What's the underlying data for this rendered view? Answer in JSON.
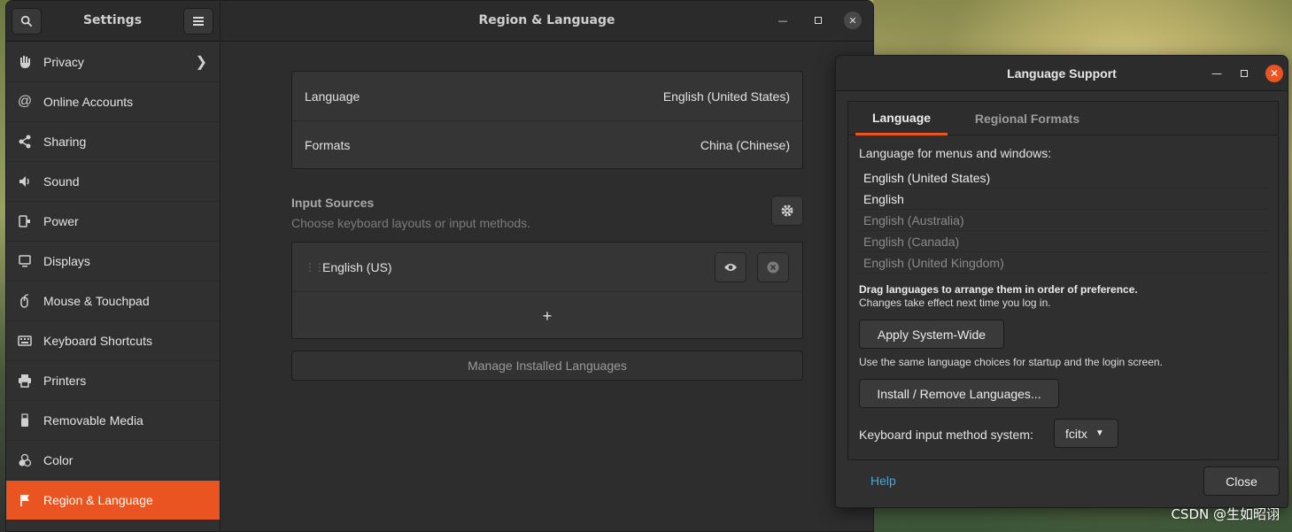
{
  "settings_window": {
    "sidebar_title": "Settings",
    "page_title": "Region & Language",
    "sidebar": [
      {
        "label": "Privacy",
        "icon": "hand-icon",
        "has_arrow": true
      },
      {
        "label": "Online Accounts",
        "icon": "at-icon"
      },
      {
        "label": "Sharing",
        "icon": "share-icon"
      },
      {
        "label": "Sound",
        "icon": "speaker-icon"
      },
      {
        "label": "Power",
        "icon": "power-plug-icon"
      },
      {
        "label": "Displays",
        "icon": "monitor-icon"
      },
      {
        "label": "Mouse & Touchpad",
        "icon": "mouse-icon"
      },
      {
        "label": "Keyboard Shortcuts",
        "icon": "keyboard-icon"
      },
      {
        "label": "Printers",
        "icon": "printer-icon"
      },
      {
        "label": "Removable Media",
        "icon": "usb-icon"
      },
      {
        "label": "Color",
        "icon": "color-circles-icon"
      },
      {
        "label": "Region & Language",
        "icon": "flag-icon",
        "active": true
      }
    ],
    "region": {
      "language_label": "Language",
      "language_value": "English (United States)",
      "formats_label": "Formats",
      "formats_value": "China (Chinese)"
    },
    "input_sources": {
      "title": "Input Sources",
      "subtitle": "Choose keyboard layouts or input methods.",
      "items": [
        "English (US)"
      ],
      "add_label": "+"
    },
    "manage_button": "Manage Installed Languages"
  },
  "dialog": {
    "title": "Language Support",
    "tabs": [
      "Language",
      "Regional Formats"
    ],
    "menus_label": "Language for menus and windows:",
    "languages": [
      {
        "label": "English (United States)",
        "enabled": true
      },
      {
        "label": "English",
        "enabled": true
      },
      {
        "label": "English (Australia)",
        "enabled": false
      },
      {
        "label": "English (Canada)",
        "enabled": false
      },
      {
        "label": "English (United Kingdom)",
        "enabled": false
      }
    ],
    "drag_note": "Drag languages to arrange them in order of preference.",
    "changes_note": "Changes take effect next time you log in.",
    "apply_button": "Apply System-Wide",
    "apply_note": "Use the same language choices for startup and the login screen.",
    "install_button": "Install / Remove Languages...",
    "input_method_label": "Keyboard input method system:",
    "input_method_value": "fcitx",
    "help_label": "Help",
    "close_label": "Close"
  },
  "watermark": "CSDN @生如昭诩",
  "colors": {
    "accent": "#e95420",
    "link": "#3fa9e0"
  }
}
